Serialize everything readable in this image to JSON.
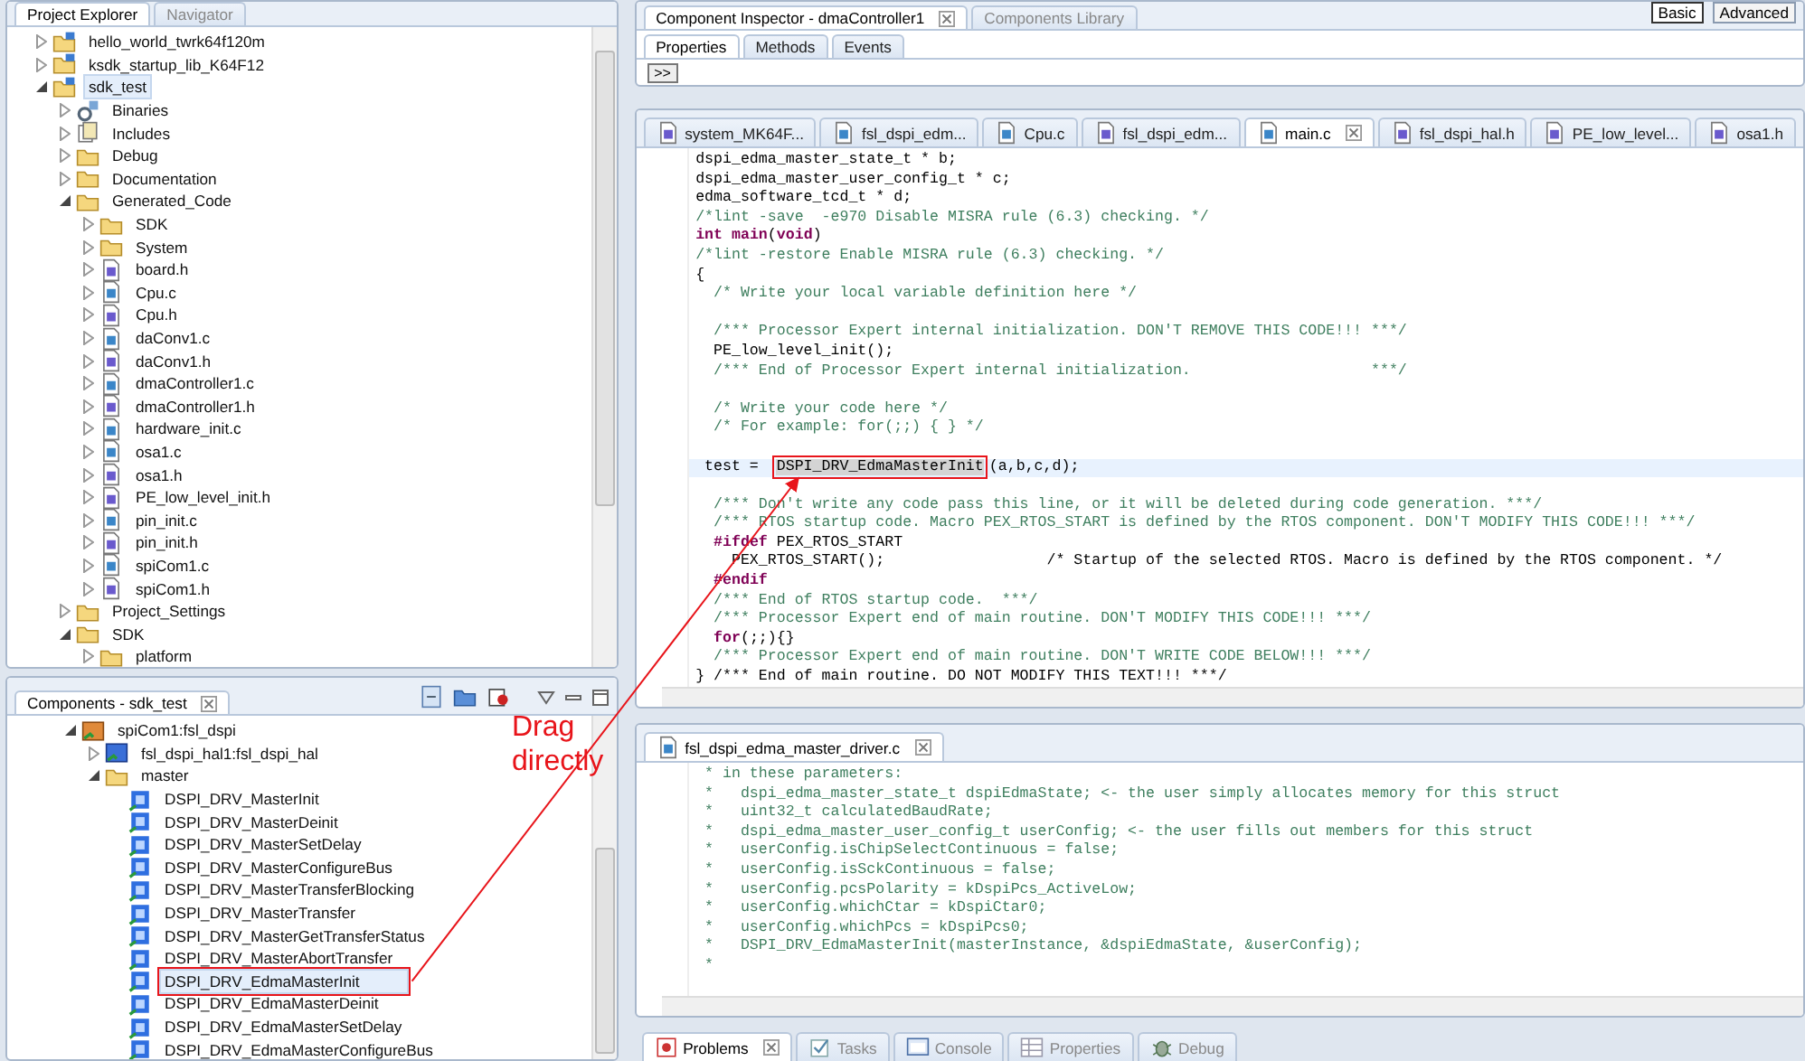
{
  "project_explorer": {
    "tabs": [
      {
        "label": "Project Explorer",
        "selected": true
      },
      {
        "label": "Navigator",
        "selected": false
      }
    ],
    "tree": [
      {
        "label": "hello_world_twrk64f120m",
        "kind": "project",
        "expanded": false,
        "selected": false
      },
      {
        "label": "ksdk_startup_lib_K64F12",
        "kind": "project",
        "expanded": false,
        "selected": false
      },
      {
        "label": "sdk_test",
        "kind": "project",
        "expanded": true,
        "selected": true,
        "children": [
          {
            "label": "Binaries",
            "kind": "binaries",
            "expanded": false,
            "selected": false
          },
          {
            "label": "Includes",
            "kind": "includes",
            "expanded": false,
            "selected": false
          },
          {
            "label": "Debug",
            "kind": "folder",
            "expanded": false,
            "selected": false
          },
          {
            "label": "Documentation",
            "kind": "folder",
            "expanded": false,
            "selected": false
          },
          {
            "label": "Generated_Code",
            "kind": "folder",
            "expanded": true,
            "selected": false,
            "children": [
              {
                "label": "SDK",
                "kind": "folder",
                "expanded": false,
                "selected": false
              },
              {
                "label": "System",
                "kind": "folder",
                "expanded": false,
                "selected": false
              },
              {
                "label": "board.h",
                "kind": "header",
                "expanded": false,
                "selected": false
              },
              {
                "label": "Cpu.c",
                "kind": "source",
                "expanded": false,
                "selected": false
              },
              {
                "label": "Cpu.h",
                "kind": "header",
                "expanded": false,
                "selected": false
              },
              {
                "label": "daConv1.c",
                "kind": "source",
                "expanded": false,
                "selected": false
              },
              {
                "label": "daConv1.h",
                "kind": "header",
                "expanded": false,
                "selected": false
              },
              {
                "label": "dmaController1.c",
                "kind": "source",
                "expanded": false,
                "selected": false
              },
              {
                "label": "dmaController1.h",
                "kind": "header",
                "expanded": false,
                "selected": false
              },
              {
                "label": "hardware_init.c",
                "kind": "source",
                "expanded": false,
                "selected": false
              },
              {
                "label": "osa1.c",
                "kind": "source",
                "expanded": false,
                "selected": false
              },
              {
                "label": "osa1.h",
                "kind": "header",
                "expanded": false,
                "selected": false
              },
              {
                "label": "PE_low_level_init.h",
                "kind": "header",
                "expanded": false,
                "selected": false
              },
              {
                "label": "pin_init.c",
                "kind": "source",
                "expanded": false,
                "selected": false
              },
              {
                "label": "pin_init.h",
                "kind": "header",
                "expanded": false,
                "selected": false
              },
              {
                "label": "spiCom1.c",
                "kind": "source",
                "expanded": false,
                "selected": false
              },
              {
                "label": "spiCom1.h",
                "kind": "header",
                "expanded": false,
                "selected": false
              }
            ]
          },
          {
            "label": "Project_Settings",
            "kind": "folder",
            "expanded": false,
            "selected": false
          },
          {
            "label": "SDK",
            "kind": "folder",
            "expanded": true,
            "selected": false,
            "children": [
              {
                "label": "platform",
                "kind": "folder",
                "expanded": false,
                "selected": false
              }
            ]
          }
        ]
      }
    ]
  },
  "components": {
    "tabs": [
      {
        "label": "Components - sdk_test",
        "selected": true
      }
    ],
    "tree": [
      {
        "label": "spiCom1:fsl_dspi",
        "kind": "component",
        "expanded": true,
        "selected": false,
        "boxed": false,
        "children": [
          {
            "label": "fsl_dspi_hal1:fsl_dspi_hal",
            "kind": "hal",
            "expanded": false,
            "selected": false,
            "boxed": false
          },
          {
            "label": "master",
            "kind": "folder",
            "expanded": true,
            "selected": false,
            "boxed": false,
            "children": [
              {
                "label": "DSPI_DRV_MasterInit",
                "kind": "method",
                "selected": false,
                "boxed": false
              },
              {
                "label": "DSPI_DRV_MasterDeinit",
                "kind": "method",
                "selected": false,
                "boxed": false
              },
              {
                "label": "DSPI_DRV_MasterSetDelay",
                "kind": "method",
                "selected": false,
                "boxed": false
              },
              {
                "label": "DSPI_DRV_MasterConfigureBus",
                "kind": "method",
                "selected": false,
                "boxed": false
              },
              {
                "label": "DSPI_DRV_MasterTransferBlocking",
                "kind": "method",
                "selected": false,
                "boxed": false
              },
              {
                "label": "DSPI_DRV_MasterTransfer",
                "kind": "method",
                "selected": false,
                "boxed": false
              },
              {
                "label": "DSPI_DRV_MasterGetTransferStatus",
                "kind": "method",
                "selected": false,
                "boxed": false
              },
              {
                "label": "DSPI_DRV_MasterAbortTransfer",
                "kind": "method",
                "selected": false,
                "boxed": false
              },
              {
                "label": "DSPI_DRV_EdmaMasterInit",
                "kind": "method",
                "selected": true,
                "boxed": true
              },
              {
                "label": "DSPI_DRV_EdmaMasterDeinit",
                "kind": "method",
                "selected": false,
                "boxed": false
              },
              {
                "label": "DSPI_DRV_EdmaMasterSetDelay",
                "kind": "method",
                "selected": false,
                "boxed": false
              },
              {
                "label": "DSPI_DRV_EdmaMasterConfigureBus",
                "kind": "method",
                "selected": false,
                "boxed": false
              }
            ]
          }
        ]
      }
    ]
  },
  "annotation": {
    "text": "Drag directly"
  },
  "inspector": {
    "tabs": [
      {
        "label": "Component Inspector - dmaController1",
        "selected": true
      },
      {
        "label": "Components Library",
        "selected": false
      }
    ],
    "modes": [
      {
        "label": "Basic",
        "selected": true
      },
      {
        "label": "Advanced",
        "selected": false
      }
    ],
    "subtabs": [
      {
        "label": "Properties",
        "selected": true
      },
      {
        "label": "Methods",
        "selected": false
      },
      {
        "label": "Events",
        "selected": false
      }
    ],
    "expand_button": ">>"
  },
  "editor": {
    "tabs": [
      {
        "label": "system_MK64F...",
        "kind": "header",
        "selected": false
      },
      {
        "label": "fsl_dspi_edm...",
        "kind": "source",
        "selected": false
      },
      {
        "label": "Cpu.c",
        "kind": "source",
        "selected": false
      },
      {
        "label": "fsl_dspi_edm...",
        "kind": "header",
        "selected": false
      },
      {
        "label": "main.c",
        "kind": "source",
        "selected": true
      },
      {
        "label": "fsl_dspi_hal.h",
        "kind": "header",
        "selected": false
      },
      {
        "label": "PE_low_level...",
        "kind": "header",
        "selected": false
      },
      {
        "label": "osa1.h",
        "kind": "header",
        "selected": false
      }
    ],
    "lines": [
      {
        "kind": "code",
        "text": "dspi_edma_master_state_t * b;",
        "current": false
      },
      {
        "kind": "code",
        "text": "dspi_edma_master_user_config_t * c;",
        "current": false
      },
      {
        "kind": "code",
        "text": "edma_software_tcd_t * d;",
        "current": false
      },
      {
        "kind": "comment",
        "text": "/*lint -save  -e970 Disable MISRA rule (6.3) checking. */",
        "current": false
      },
      {
        "kind": "keyword",
        "text": "**int** **main**(**void**)",
        "current": false
      },
      {
        "kind": "comment",
        "text": "/*lint -restore Enable MISRA rule (6.3) checking. */",
        "current": false
      },
      {
        "kind": "code",
        "text": "{",
        "current": false
      },
      {
        "kind": "comment",
        "text": "  /* Write your local variable definition here */",
        "current": false
      },
      {
        "kind": "blank",
        "current": false
      },
      {
        "kind": "comment",
        "text": "  /*** Processor Expert internal initialization. DON'T REMOVE THIS CODE!!! ***/",
        "current": false
      },
      {
        "kind": "code",
        "text": "  PE_low_level_init();",
        "current": false
      },
      {
        "kind": "comment",
        "text": "  /*** End of Processor Expert internal initialization.                    ***/",
        "current": false
      },
      {
        "kind": "blank",
        "current": false
      },
      {
        "kind": "comment",
        "text": "  /* Write your code here */",
        "current": false
      },
      {
        "kind": "comment",
        "text": "  /* For example: for(;;) { } */",
        "current": false
      },
      {
        "kind": "blank",
        "current": false
      },
      {
        "kind": "marked",
        "before": " test =  ",
        "marked": "DSPI_DRV_EdmaMasterInit",
        "after": "(a,b,c,d);",
        "current": true
      },
      {
        "kind": "blank",
        "current": false
      },
      {
        "kind": "comment",
        "text": "  /*** Don't write any code pass this line, or it will be deleted during code generation. ***/",
        "current": false
      },
      {
        "kind": "comment",
        "text": "  /*** RTOS startup code. Macro PEX_RTOS_START is defined by the RTOS component. DON'T MODIFY THIS CODE!!! ***/",
        "current": false
      },
      {
        "kind": "keyword",
        "text": "  **#ifdef** PEX_RTOS_START",
        "current": false
      },
      {
        "kind": "code",
        "text": "    PEX_RTOS_START();                  /* Startup of the selected RTOS. Macro is defined by the RTOS component. */",
        "current": false
      },
      {
        "kind": "keyword",
        "text": "  **#endif**",
        "current": false
      },
      {
        "kind": "comment",
        "text": "  /*** End of RTOS startup code.  ***/",
        "current": false
      },
      {
        "kind": "comment",
        "text": "  /*** Processor Expert end of main routine. DON'T MODIFY THIS CODE!!! ***/",
        "current": false
      },
      {
        "kind": "keyword",
        "text": "  **for**(;;){}",
        "current": false
      },
      {
        "kind": "comment",
        "text": "  /*** Processor Expert end of main routine. DON'T WRITE CODE BELOW!!! ***/",
        "current": false
      },
      {
        "kind": "code",
        "text": "} /*** End of main routine. DO NOT MODIFY THIS TEXT!!! ***/",
        "current": false
      }
    ]
  },
  "second_editor": {
    "tabs": [
      {
        "label": "fsl_dspi_edma_master_driver.c",
        "kind": "source",
        "selected": true
      }
    ],
    "lines": [
      {
        "kind": "comment",
        "text": " * in these parameters:",
        "current": false
      },
      {
        "kind": "comment",
        "text": " *   dspi_edma_master_state_t dspiEdmaState; <- the user simply allocates memory for this struct",
        "current": false
      },
      {
        "kind": "comment",
        "text": " *   uint32_t calculatedBaudRate;",
        "current": false
      },
      {
        "kind": "comment",
        "text": " *   dspi_edma_master_user_config_t userConfig; <- the user fills out members for this struct",
        "current": false
      },
      {
        "kind": "comment",
        "text": " *   userConfig.isChipSelectContinuous = false;",
        "current": false
      },
      {
        "kind": "comment",
        "text": " *   userConfig.isSckContinuous = false;",
        "current": false
      },
      {
        "kind": "comment",
        "text": " *   userConfig.pcsPolarity = kDspiPcs_ActiveLow;",
        "current": false
      },
      {
        "kind": "comment",
        "text": " *   userConfig.whichCtar = kDspiCtar0;",
        "current": false
      },
      {
        "kind": "comment",
        "text": " *   userConfig.whichPcs = kDspiPcs0;",
        "current": false
      },
      {
        "kind": "comment",
        "text": " *   DSPI_DRV_EdmaMasterInit(masterInstance, &dspiEdmaState, &userConfig);",
        "current": false
      },
      {
        "kind": "comment",
        "text": " *",
        "current": false
      }
    ]
  },
  "bottom_views": {
    "tabs": [
      {
        "label": "Problems",
        "kind": "problems",
        "selected": true
      },
      {
        "label": "Tasks",
        "kind": "tasks",
        "selected": false
      },
      {
        "label": "Console",
        "kind": "console",
        "selected": false
      },
      {
        "label": "Properties",
        "kind": "properties",
        "selected": false
      },
      {
        "label": "Debug",
        "kind": "debug",
        "selected": false
      }
    ]
  }
}
